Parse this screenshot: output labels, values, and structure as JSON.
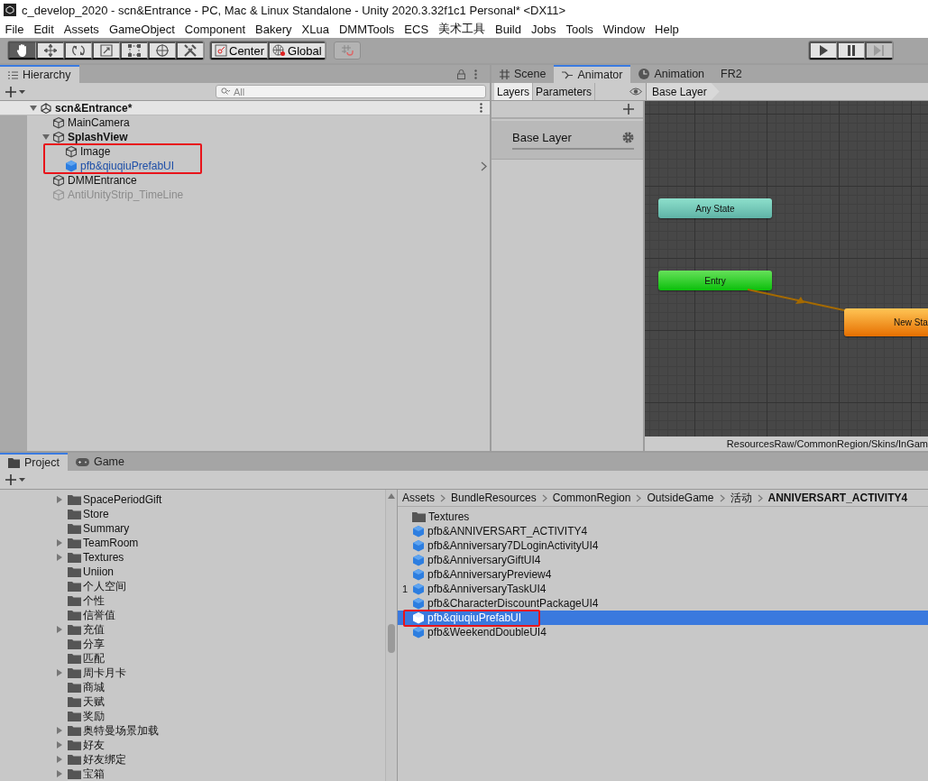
{
  "window": {
    "title": "c_develop_2020 - scn&Entrance - PC, Mac & Linux Standalone - Unity 2020.3.32f1c1 Personal* <DX11>"
  },
  "menu": [
    "File",
    "Edit",
    "Assets",
    "GameObject",
    "Component",
    "Bakery",
    "XLua",
    "DMMTools",
    "ECS",
    "美术工具",
    "Build",
    "Jobs",
    "Tools",
    "Window",
    "Help"
  ],
  "toolbar": {
    "tools": [
      {
        "kind": "hand",
        "selected": true
      },
      {
        "kind": "move",
        "selected": false
      },
      {
        "kind": "rotate",
        "selected": false
      },
      {
        "kind": "scale",
        "selected": false
      },
      {
        "kind": "rect",
        "selected": false
      },
      {
        "kind": "transform",
        "selected": false
      },
      {
        "kind": "custom",
        "selected": false
      }
    ],
    "pivot_buttons": [
      {
        "kind": "pivot",
        "label": "Center"
      },
      {
        "kind": "space",
        "label": "Global"
      }
    ],
    "snap": {
      "disabled": true
    },
    "play_buttons": [
      {
        "kind": "play",
        "disabled": false
      },
      {
        "kind": "pause",
        "disabled": false
      },
      {
        "kind": "step",
        "disabled": true
      }
    ]
  },
  "hierarchy": {
    "tab": "Hierarchy",
    "search": {
      "placeholder": "All"
    },
    "scene": {
      "label": "scn&Entrance*",
      "expanded": true,
      "children": [
        {
          "label": "MainCamera",
          "kind": "object",
          "bold": false,
          "disabled": false
        },
        {
          "label": "SplashView",
          "kind": "object",
          "bold": true,
          "disabled": false,
          "expanded": true,
          "children_framed": true,
          "children": [
            {
              "label": "Image",
              "kind": "object",
              "bold": false,
              "disabled": false
            },
            {
              "label": "pfb&qiuqiuPrefabUI",
              "kind": "prefab",
              "bold": false,
              "disabled": false,
              "has_arrow": true
            }
          ]
        },
        {
          "label": "DMMEntrance",
          "kind": "object",
          "bold": false,
          "disabled": false
        },
        {
          "label": "AntiUnityStrip_TimeLine",
          "kind": "object",
          "bold": false,
          "disabled": true
        }
      ]
    }
  },
  "animator": {
    "tabs": [
      {
        "label": "Scene",
        "kind": "scene",
        "selected": false
      },
      {
        "label": "Animator",
        "kind": "animator",
        "selected": true
      },
      {
        "label": "Animation",
        "kind": "animation",
        "selected": false
      },
      {
        "label": "FR2",
        "kind": "plain",
        "selected": false
      }
    ],
    "subtabs": [
      {
        "label": "Layers",
        "selected": true
      },
      {
        "label": "Parameters",
        "selected": false
      }
    ],
    "breadcrumb": "Base Layer",
    "layers": [
      {
        "name": "Base Layer"
      }
    ],
    "nodes": [
      {
        "label": "Any State",
        "kind": "any"
      },
      {
        "label": "Entry",
        "kind": "entry"
      },
      {
        "label": "New Sta",
        "kind": "default"
      }
    ],
    "status_path": "ResourcesRaw/CommonRegion/Skins/InGam"
  },
  "project": {
    "tabs": [
      {
        "label": "Project",
        "kind": "project",
        "selected": true
      },
      {
        "label": "Game",
        "kind": "game",
        "selected": false
      }
    ],
    "tree": [
      {
        "label": "SpacePeriodGift",
        "expandable": true
      },
      {
        "label": "Store",
        "expandable": false
      },
      {
        "label": "Summary",
        "expandable": false
      },
      {
        "label": "TeamRoom",
        "expandable": true
      },
      {
        "label": "Textures",
        "expandable": true
      },
      {
        "label": "Uniion",
        "expandable": false
      },
      {
        "label": "个人空间",
        "expandable": false
      },
      {
        "label": "个性",
        "expandable": false
      },
      {
        "label": "信誉值",
        "expandable": false
      },
      {
        "label": "充值",
        "expandable": true
      },
      {
        "label": "分享",
        "expandable": false
      },
      {
        "label": "匹配",
        "expandable": false
      },
      {
        "label": "周卡月卡",
        "expandable": true
      },
      {
        "label": "商城",
        "expandable": false
      },
      {
        "label": "天赋",
        "expandable": false
      },
      {
        "label": "奖励",
        "expandable": false
      },
      {
        "label": "奥特曼场景加载",
        "expandable": true
      },
      {
        "label": "好友",
        "expandable": true
      },
      {
        "label": "好友绑定",
        "expandable": true
      },
      {
        "label": "宝箱",
        "expandable": true
      }
    ],
    "breadcrumb": [
      "Assets",
      "BundleResources",
      "CommonRegion",
      "OutsideGame",
      "活动",
      "ANNIVERSART_ACTIVITY4"
    ],
    "items": [
      {
        "label": "Textures",
        "kind": "folder",
        "selected": false
      },
      {
        "label": "pfb&ANNIVERSART_ACTIVITY4",
        "kind": "prefab",
        "selected": false
      },
      {
        "label": "pfb&Anniversary7DLoginActivityUI4",
        "kind": "prefab",
        "selected": false
      },
      {
        "label": "pfb&AnniversaryGiftUI4",
        "kind": "prefab",
        "selected": false
      },
      {
        "label": "pfb&AnniversaryPreview4",
        "kind": "prefab",
        "selected": false
      },
      {
        "label": "pfb&AnniversaryTaskUI4",
        "kind": "prefab",
        "selected": false,
        "count": "1"
      },
      {
        "label": "pfb&CharacterDiscountPackageUI4",
        "kind": "prefab",
        "selected": false
      },
      {
        "label": "pfb&qiuqiuPrefabUI",
        "kind": "prefab",
        "selected": true,
        "framed": true
      },
      {
        "label": "pfb&WeekendDoubleUI4",
        "kind": "prefab",
        "selected": false
      }
    ]
  }
}
